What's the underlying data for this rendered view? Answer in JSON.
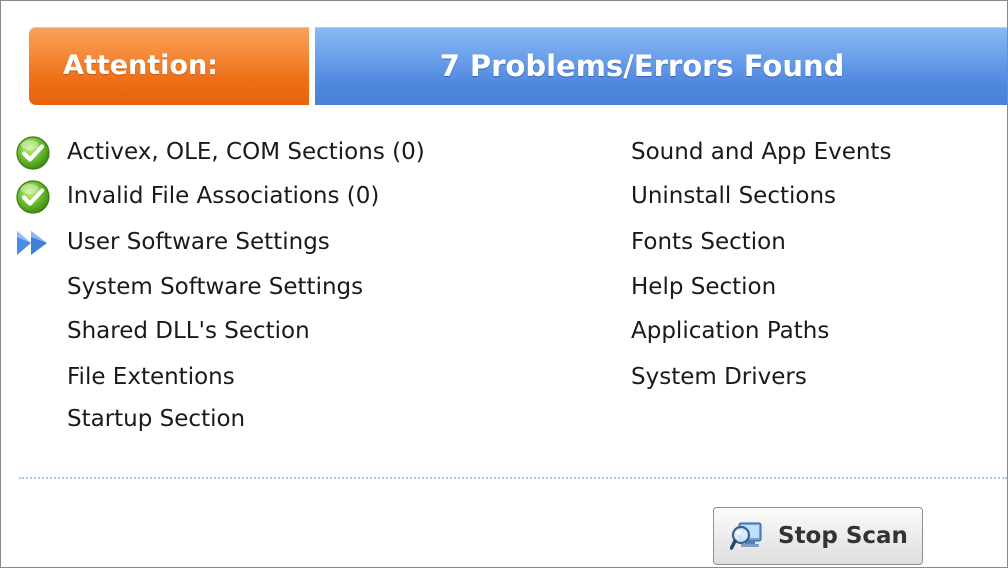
{
  "banner": {
    "attention_label": "Attention:",
    "problems_label": "7 Problems/Errors Found",
    "attention_color": "#ee6d14",
    "problems_color": "#4f86de"
  },
  "sections": {
    "left": [
      {
        "label": "Activex, OLE, COM Sections (0)",
        "status": "done",
        "icon": "check-icon"
      },
      {
        "label": "Invalid File Associations (0)",
        "status": "done",
        "icon": "check-icon"
      },
      {
        "label": "User Software Settings",
        "status": "scanning",
        "icon": "double-arrow-icon"
      },
      {
        "label": "System Software Settings",
        "status": "pending"
      },
      {
        "label": "Shared DLL's Section",
        "status": "pending"
      },
      {
        "label": "File Extentions",
        "status": "pending"
      },
      {
        "label": "Startup Section",
        "status": "pending"
      }
    ],
    "right": [
      {
        "label": "Sound and App Events",
        "status": "pending"
      },
      {
        "label": "Uninstall Sections",
        "status": "pending"
      },
      {
        "label": "Fonts Section",
        "status": "pending"
      },
      {
        "label": "Help Section",
        "status": "pending"
      },
      {
        "label": "Application Paths",
        "status": "pending"
      },
      {
        "label": "System Drivers",
        "status": "pending"
      }
    ]
  },
  "actions": {
    "stop_scan_label": "Stop Scan",
    "stop_scan_icon": "scan-magnifier-icon"
  }
}
